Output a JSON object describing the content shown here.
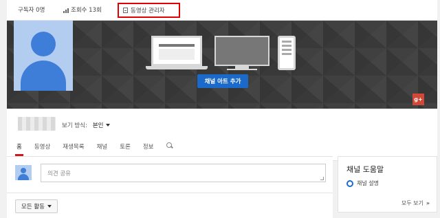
{
  "topbar": {
    "subscribers": "구독자 0명",
    "views": "조회수 13회",
    "video_manager": "동영상 관리자"
  },
  "banner": {
    "add_art_label": "채널 아트 추가",
    "gplus_label": "g+"
  },
  "channel": {
    "view_as_label": "보기 방식:",
    "view_as_value": "본인",
    "tabs": [
      {
        "label": "홈"
      },
      {
        "label": "동영상"
      },
      {
        "label": "재생목록"
      },
      {
        "label": "채널"
      },
      {
        "label": "토론"
      },
      {
        "label": "정보"
      }
    ]
  },
  "feed": {
    "share_placeholder": "의견 공유",
    "activity_label": "모든 활동"
  },
  "help": {
    "title": "채널 도움말",
    "item": "채널 설명",
    "see_all": "모두 보기",
    "see_all_arrow": "»"
  },
  "colors": {
    "accent_red": "#cc181e",
    "highlight_box": "#e00000",
    "button_blue": "#1b6ac9",
    "gplus_red": "#d14836"
  }
}
